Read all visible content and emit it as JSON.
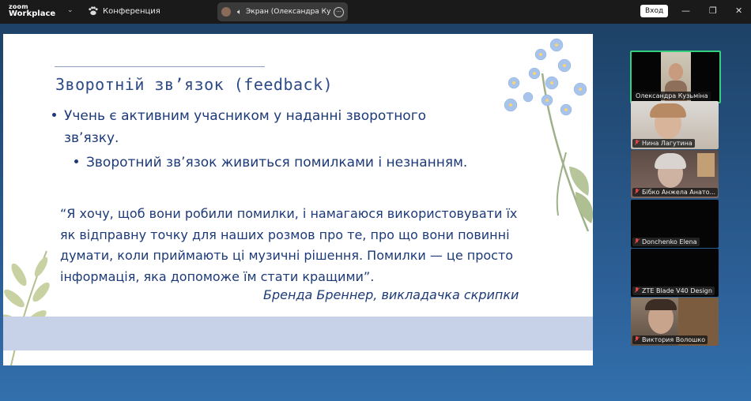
{
  "app": {
    "logo_line1": "zoom",
    "logo_line2": "Workplace",
    "meeting_label": "Конференция",
    "share_title": "Экран (Олександра Кузьмін",
    "signin_label": "Вход"
  },
  "slide": {
    "title": "Зворотній зв’язок (feedback)",
    "bullet1_line1": "Учень є активним учасником у наданні зворотного",
    "bullet1_line2": "зв’язку.",
    "bullet2": "Зворотний зв’язок живиться помилками і незнанням.",
    "quote": "“Я хочу, щоб вони робили помилки, і намагаюся використовувати їх\nяк відправну точку для наших розмов про те, про що вони повинні\nдумати, коли приймають ці музичні рішення. Помилки — це просто\nінформація, яка допоможе їм стати кращими”.",
    "author": "Бренда Бреннер, викладачка скрипки"
  },
  "participants": [
    {
      "name": "Олександра Кузьміна",
      "active": true,
      "muted": false
    },
    {
      "name": "Нина Лагутина",
      "active": false,
      "muted": true
    },
    {
      "name": "Бібко Анжела Анато...",
      "active": false,
      "muted": true
    },
    {
      "name": "Donchenko Elena",
      "active": false,
      "muted": true
    },
    {
      "name": "ZTE Blade V40 Design",
      "active": false,
      "muted": true
    },
    {
      "name": "Виктория Волошко",
      "active": false,
      "muted": true
    }
  ],
  "colors": {
    "accent_active": "#34d17b",
    "muted_mic": "#e14444",
    "slide_text": "#1d3a78"
  }
}
